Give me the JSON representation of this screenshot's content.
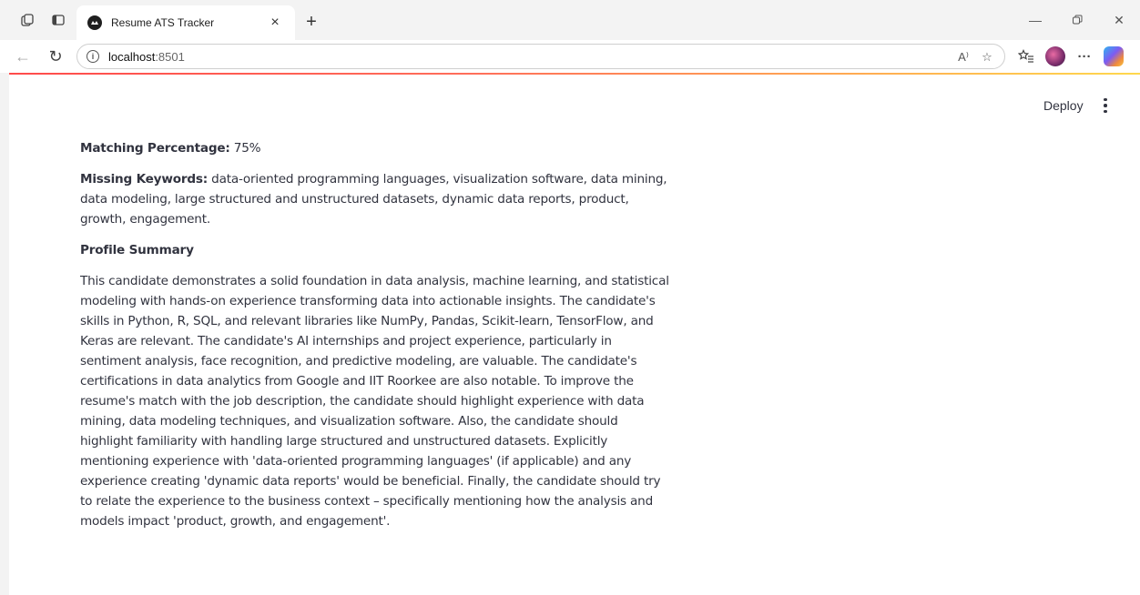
{
  "browser": {
    "tab_title": "Resume ATS Tracker",
    "url_host": "localhost",
    "url_port": ":8501",
    "read_aloud_label": "A⁾"
  },
  "app": {
    "deploy_label": "Deploy",
    "matching_label": "Matching Percentage:",
    "matching_value": " 75%",
    "missing_label": "Missing Keywords:",
    "missing_value": " data-oriented programming languages, visualization software, data mining, data modeling, large structured and unstructured datasets, dynamic data reports, product, growth, engagement.",
    "profile_heading": "Profile Summary",
    "profile_text": "This candidate demonstrates a solid foundation in data analysis, machine learning, and statistical modeling with hands-on experience transforming data into actionable insights. The candidate's skills in Python, R, SQL, and relevant libraries like NumPy, Pandas, Scikit-learn, TensorFlow, and Keras are relevant. The candidate's AI internships and project experience, particularly in sentiment analysis, face recognition, and predictive modeling, are valuable. The candidate's certifications in data analytics from Google and IIT Roorkee are also notable. To improve the resume's match with the job description, the candidate should highlight experience with data mining, data modeling techniques, and visualization software. Also, the candidate should highlight familiarity with handling large structured and unstructured datasets. Explicitly mentioning experience with 'data-oriented programming languages' (if applicable) and any experience creating 'dynamic data reports' would be beneficial. Finally, the candidate should try to relate the experience to the business context – specifically mentioning how the analysis and models impact 'product, growth, and engagement'."
  },
  "colors": {
    "accent_start": "#ff4b4b",
    "accent_end": "#ffd84d",
    "text": "#31333f"
  }
}
